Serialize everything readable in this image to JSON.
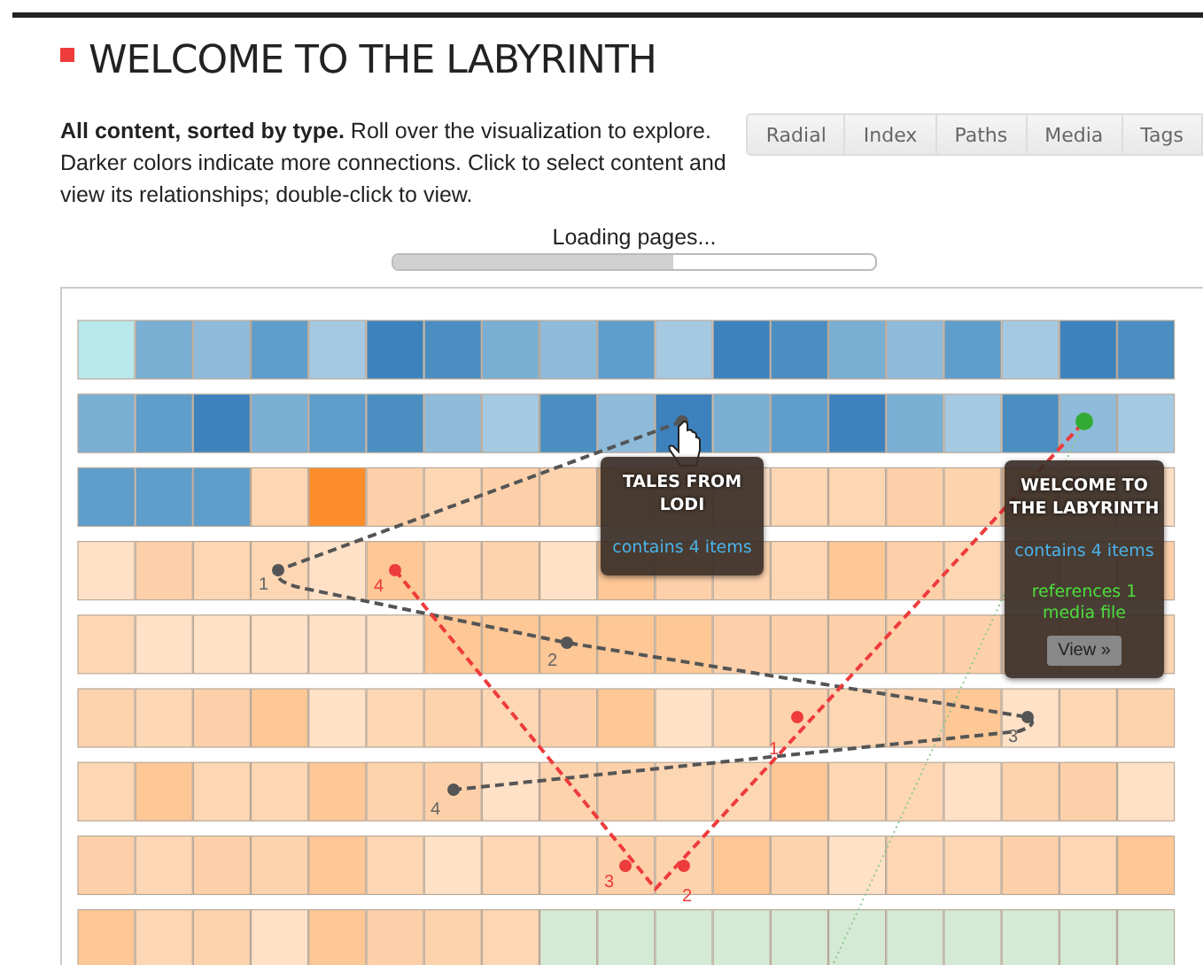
{
  "header": {
    "title": "WELCOME TO THE LABYRINTH"
  },
  "intro": "**All content, sorted by type.** Roll over the visualization to explore. Darker colors indicate more connections. Click to select content and view its relationships; double-click to view.",
  "tabs": [
    {
      "label": "Radial",
      "selected": false
    },
    {
      "label": "Index",
      "selected": false
    },
    {
      "label": "Paths",
      "selected": false
    },
    {
      "label": "Media",
      "selected": false
    },
    {
      "label": "Tags",
      "selected": false
    }
  ],
  "loading": {
    "label": "Loading pages...",
    "level": 0.58
  },
  "visualization": {
    "paths": [
      {
        "color": "#555555",
        "labels": [
          "1",
          "2",
          "3",
          "4"
        ]
      },
      {
        "color": "#ee3b3b",
        "labels": [
          "1",
          "2",
          "3",
          "4"
        ]
      }
    ],
    "tooltips": [
      {
        "title": "TALES FROM LODI",
        "contains": "contains 4 items"
      },
      {
        "title": "WELCOME TO THE LABYRINTH",
        "contains": "contains 4 items",
        "references": "references 1 media file",
        "button": "View »"
      }
    ]
  }
}
